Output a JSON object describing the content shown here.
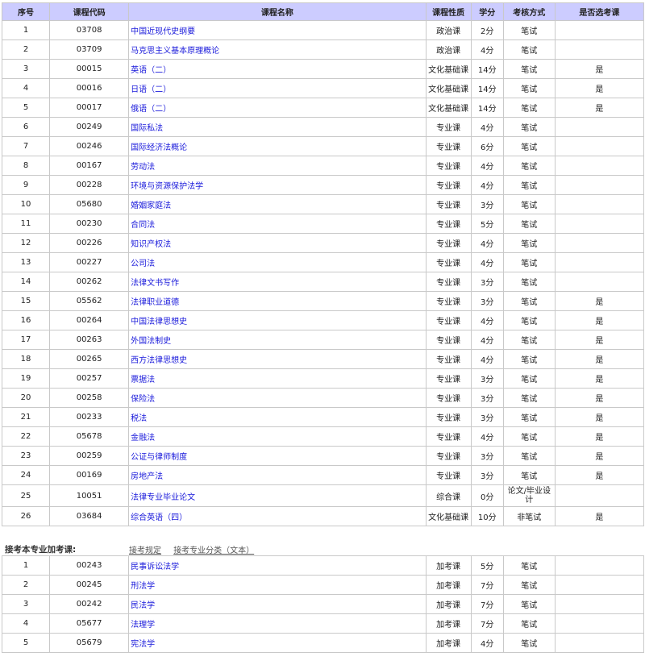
{
  "headers": [
    "序号",
    "课程代码",
    "课程名称",
    "课程性质",
    "学分",
    "考核方式",
    "是否选考课"
  ],
  "courses": [
    {
      "no": "1",
      "code": "03708",
      "name": "中国近现代史纲要",
      "type": "政治课",
      "credit": "2分",
      "exam": "笔试",
      "elective": ""
    },
    {
      "no": "2",
      "code": "03709",
      "name": "马克思主义基本原理概论",
      "type": "政治课",
      "credit": "4分",
      "exam": "笔试",
      "elective": ""
    },
    {
      "no": "3",
      "code": "00015",
      "name": "英语（二）",
      "type": "文化基础课",
      "credit": "14分",
      "exam": "笔试",
      "elective": "是"
    },
    {
      "no": "4",
      "code": "00016",
      "name": "日语（二）",
      "type": "文化基础课",
      "credit": "14分",
      "exam": "笔试",
      "elective": "是"
    },
    {
      "no": "5",
      "code": "00017",
      "name": "俄语（二）",
      "type": "文化基础课",
      "credit": "14分",
      "exam": "笔试",
      "elective": "是"
    },
    {
      "no": "6",
      "code": "00249",
      "name": "国际私法",
      "type": "专业课",
      "credit": "4分",
      "exam": "笔试",
      "elective": ""
    },
    {
      "no": "7",
      "code": "00246",
      "name": "国际经济法概论",
      "type": "专业课",
      "credit": "6分",
      "exam": "笔试",
      "elective": ""
    },
    {
      "no": "8",
      "code": "00167",
      "name": "劳动法",
      "type": "专业课",
      "credit": "4分",
      "exam": "笔试",
      "elective": ""
    },
    {
      "no": "9",
      "code": "00228",
      "name": "环境与资源保护法学",
      "type": "专业课",
      "credit": "4分",
      "exam": "笔试",
      "elective": ""
    },
    {
      "no": "10",
      "code": "05680",
      "name": "婚姻家庭法",
      "type": "专业课",
      "credit": "3分",
      "exam": "笔试",
      "elective": ""
    },
    {
      "no": "11",
      "code": "00230",
      "name": "合同法",
      "type": "专业课",
      "credit": "5分",
      "exam": "笔试",
      "elective": ""
    },
    {
      "no": "12",
      "code": "00226",
      "name": "知识产权法",
      "type": "专业课",
      "credit": "4分",
      "exam": "笔试",
      "elective": ""
    },
    {
      "no": "13",
      "code": "00227",
      "name": "公司法",
      "type": "专业课",
      "credit": "4分",
      "exam": "笔试",
      "elective": ""
    },
    {
      "no": "14",
      "code": "00262",
      "name": "法律文书写作",
      "type": "专业课",
      "credit": "3分",
      "exam": "笔试",
      "elective": ""
    },
    {
      "no": "15",
      "code": "05562",
      "name": "法律职业道德",
      "type": "专业课",
      "credit": "3分",
      "exam": "笔试",
      "elective": "是"
    },
    {
      "no": "16",
      "code": "00264",
      "name": "中国法律思想史",
      "type": "专业课",
      "credit": "4分",
      "exam": "笔试",
      "elective": "是"
    },
    {
      "no": "17",
      "code": "00263",
      "name": "外国法制史",
      "type": "专业课",
      "credit": "4分",
      "exam": "笔试",
      "elective": "是"
    },
    {
      "no": "18",
      "code": "00265",
      "name": "西方法律思想史",
      "type": "专业课",
      "credit": "4分",
      "exam": "笔试",
      "elective": "是"
    },
    {
      "no": "19",
      "code": "00257",
      "name": "票据法",
      "type": "专业课",
      "credit": "3分",
      "exam": "笔试",
      "elective": "是"
    },
    {
      "no": "20",
      "code": "00258",
      "name": "保险法",
      "type": "专业课",
      "credit": "3分",
      "exam": "笔试",
      "elective": "是"
    },
    {
      "no": "21",
      "code": "00233",
      "name": "税法",
      "type": "专业课",
      "credit": "3分",
      "exam": "笔试",
      "elective": "是"
    },
    {
      "no": "22",
      "code": "05678",
      "name": "金融法",
      "type": "专业课",
      "credit": "4分",
      "exam": "笔试",
      "elective": "是"
    },
    {
      "no": "23",
      "code": "00259",
      "name": "公证与律师制度",
      "type": "专业课",
      "credit": "3分",
      "exam": "笔试",
      "elective": "是"
    },
    {
      "no": "24",
      "code": "00169",
      "name": "房地产法",
      "type": "专业课",
      "credit": "3分",
      "exam": "笔试",
      "elective": "是"
    },
    {
      "no": "25",
      "code": "10051",
      "name": "法律专业毕业论文",
      "type": "综合课",
      "credit": "0分",
      "exam": "论文/毕业设计",
      "elective": ""
    },
    {
      "no": "26",
      "code": "03684",
      "name": "综合英语（四）",
      "type": "文化基础课",
      "credit": "10分",
      "exam": "非笔试",
      "elective": "是"
    }
  ],
  "section": {
    "title": "接考本专业加考课:",
    "links": [
      "接考规定",
      "接考专业分类（文本）"
    ]
  },
  "extra_courses": [
    {
      "no": "1",
      "code": "00243",
      "name": "民事诉讼法学",
      "type": "加考课",
      "credit": "5分",
      "exam": "笔试",
      "elective": ""
    },
    {
      "no": "2",
      "code": "00245",
      "name": "刑法学",
      "type": "加考课",
      "credit": "7分",
      "exam": "笔试",
      "elective": ""
    },
    {
      "no": "3",
      "code": "00242",
      "name": "民法学",
      "type": "加考课",
      "credit": "7分",
      "exam": "笔试",
      "elective": ""
    },
    {
      "no": "4",
      "code": "05677",
      "name": "法理学",
      "type": "加考课",
      "credit": "7分",
      "exam": "笔试",
      "elective": ""
    },
    {
      "no": "5",
      "code": "05679",
      "name": "宪法学",
      "type": "加考课",
      "credit": "4分",
      "exam": "笔试",
      "elective": ""
    }
  ],
  "colors": {
    "header_bg": "#ccccff",
    "link": "#1a1adb",
    "border": "#c9c9c9"
  }
}
